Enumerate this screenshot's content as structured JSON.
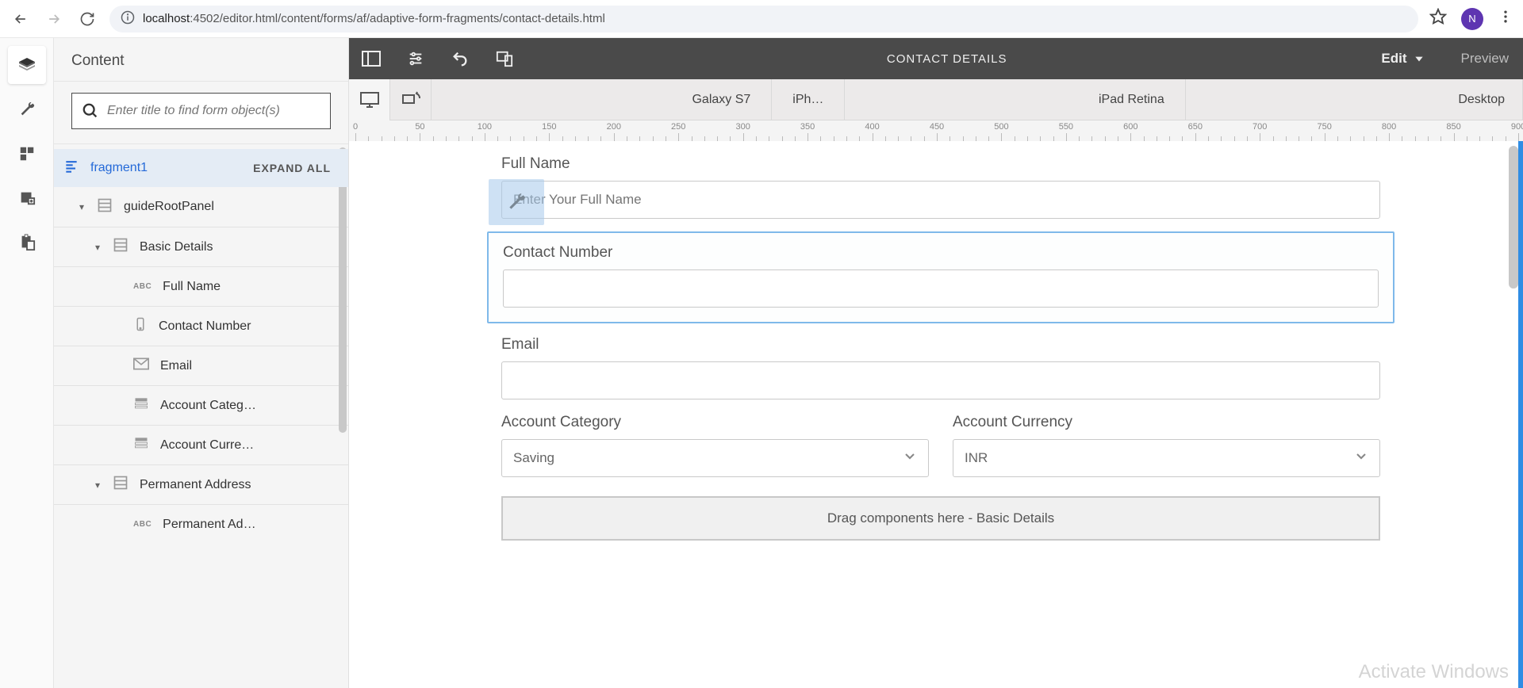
{
  "browser": {
    "url_host": "localhost",
    "url_port": ":4502",
    "url_path": "/editor.html/content/forms/af/adaptive-form-fragments/contact-details.html",
    "avatar_initial": "N"
  },
  "sidebar": {
    "title": "Content",
    "search_placeholder": "Enter title to find form object(s)",
    "fragment_label": "fragment1",
    "expand_all": "EXPAND ALL",
    "nodes": {
      "root": "guideRootPanel",
      "basic": "Basic Details",
      "fullname": "Full Name",
      "contact": "Contact Number",
      "email": "Email",
      "acct_cat": "Account Categ…",
      "acct_cur": "Account Curre…",
      "perm_addr": "Permanent Address",
      "perm_ad": "Permanent Ad…"
    }
  },
  "toolbar": {
    "title": "CONTACT DETAILS",
    "edit": "Edit",
    "preview": "Preview"
  },
  "devicebar": {
    "galaxy": "Galaxy S7",
    "iphone": "iPh…",
    "ipad": "iPad Retina",
    "desktop": "Desktop"
  },
  "ruler": {
    "marks": [
      "0",
      "50",
      "100",
      "150",
      "200",
      "250",
      "300",
      "350",
      "400",
      "450",
      "500",
      "550",
      "600",
      "650",
      "700",
      "750",
      "800",
      "850",
      "900"
    ]
  },
  "form": {
    "fullname_label": "Full Name",
    "fullname_placeholder": "Enter Your Full Name",
    "contact_label": "Contact Number",
    "email_label": "Email",
    "acct_cat_label": "Account Category",
    "acct_cat_value": "Saving",
    "acct_cur_label": "Account Currency",
    "acct_cur_value": "INR",
    "dropzone": "Drag components here - Basic Details"
  },
  "watermark": "Activate Windows"
}
